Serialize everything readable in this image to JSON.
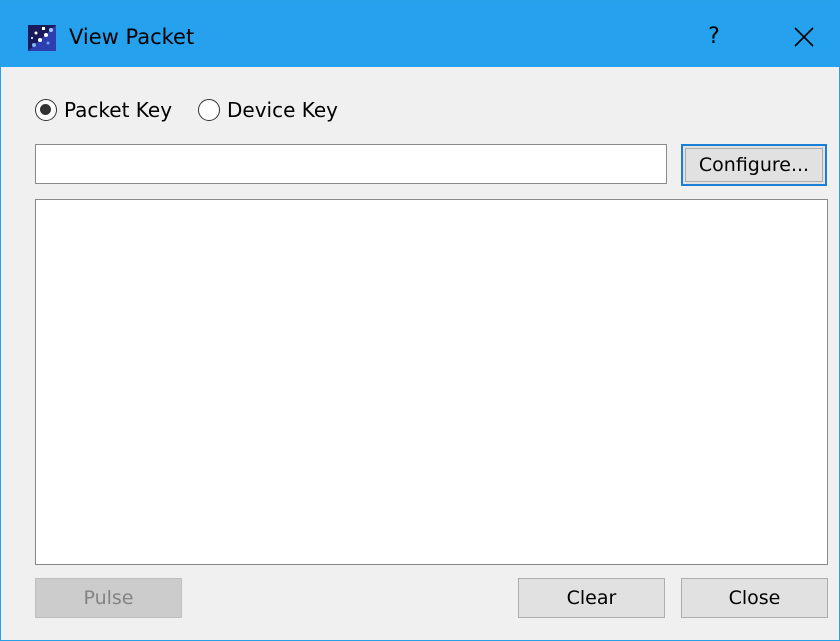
{
  "window": {
    "title": "View Packet",
    "help_label": "?",
    "app_icon": "app-icon",
    "close_icon": "close-icon"
  },
  "mode": {
    "options": [
      {
        "label": "Packet Key",
        "selected": true
      },
      {
        "label": "Device Key",
        "selected": false
      }
    ]
  },
  "key_input": {
    "value": "",
    "placeholder": ""
  },
  "buttons": {
    "configure": "Configure...",
    "pulse": "Pulse",
    "pulse_enabled": false,
    "clear": "Clear",
    "close": "Close"
  },
  "colors": {
    "titlebar": "#26a1ee",
    "window_bg": "#f0f0f0",
    "focus_border": "#1a7fd6"
  }
}
